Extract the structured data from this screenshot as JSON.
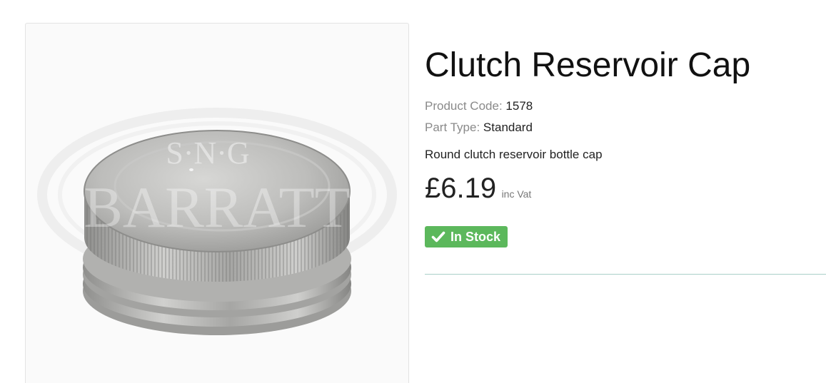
{
  "product": {
    "title": "Clutch Reservoir Cap",
    "code_label": "Product Code:",
    "code_value": "1578",
    "type_label": "Part Type:",
    "type_value": "Standard",
    "description": "Round clutch reservoir bottle cap",
    "price": "£6.19",
    "price_note": "inc Vat",
    "stock_label": "In Stock",
    "stock_icon": "check-icon"
  },
  "image": {
    "watermark_line1": "S·N·G",
    "watermark_line2": "BARRATT"
  },
  "colors": {
    "stock_badge": "#5cb85c",
    "divider": "#a9d0c8",
    "label_text": "#8a8a8a"
  }
}
